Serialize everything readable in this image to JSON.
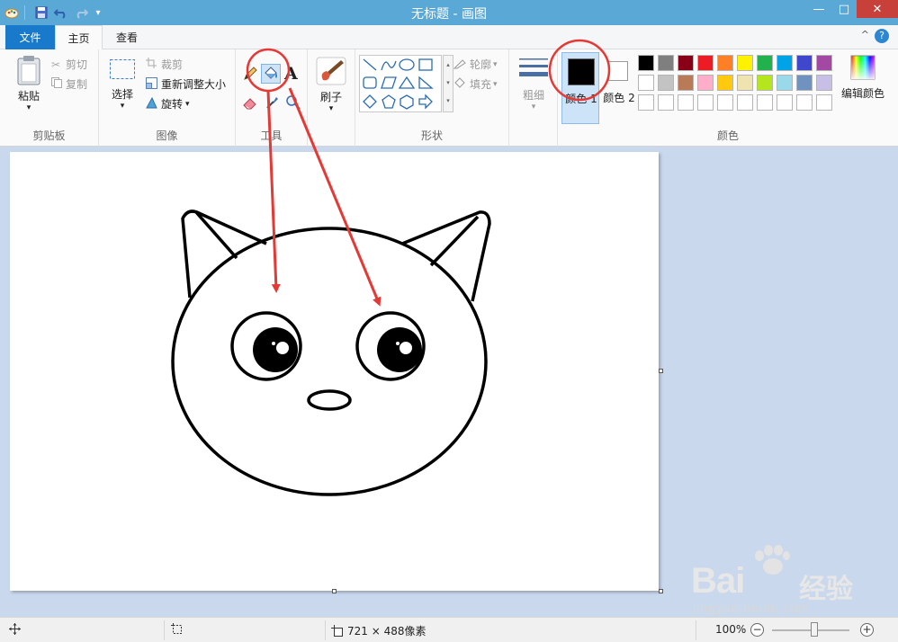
{
  "window": {
    "title": "无标题 - 画图",
    "buttons": {
      "minimize": "—",
      "maximize": "□",
      "close": "✕"
    }
  },
  "tabs": [
    {
      "label": "文件"
    },
    {
      "label": "主页"
    },
    {
      "label": "查看"
    }
  ],
  "help": "?",
  "collapse": "^",
  "ribbon": {
    "clipboard": {
      "label": "剪贴板",
      "paste": "粘贴",
      "cut": "剪切",
      "copy": "复制"
    },
    "image": {
      "label": "图像",
      "select": "选择",
      "crop": "裁剪",
      "resize": "重新调整大小",
      "rotate": "旋转"
    },
    "tools": {
      "label": "工具",
      "text_glyph": "A"
    },
    "brushes": {
      "label": "刷子"
    },
    "shapes": {
      "label": "形状",
      "outline": "轮廓",
      "fill": "填充"
    },
    "size": {
      "label": "粗细"
    },
    "colors": {
      "label": "颜色",
      "color1": "颜色 1",
      "color2": "颜色 2",
      "edit": "编辑颜色",
      "color1_value": "#000000",
      "color2_value": "#ffffff",
      "palette_row1": [
        "#000000",
        "#7f7f7f",
        "#880015",
        "#ed1c24",
        "#ff7f27",
        "#fff200",
        "#22b14c",
        "#00a2e8",
        "#3f48cc",
        "#a349a4"
      ],
      "palette_row2": [
        "#ffffff",
        "#c3c3c3",
        "#b97a57",
        "#ffaec9",
        "#ffc90e",
        "#efe4b0",
        "#b5e61d",
        "#99d9ea",
        "#7092be",
        "#c8bfe7"
      ],
      "palette_row3": [
        "#ffffff",
        "#ffffff",
        "#ffffff",
        "#ffffff",
        "#ffffff",
        "#ffffff",
        "#ffffff",
        "#ffffff",
        "#ffffff",
        "#ffffff"
      ]
    }
  },
  "status": {
    "canvas_size": "721 × 488像素",
    "zoom": "100%",
    "zoom_level": 1.0
  },
  "watermark": {
    "brand": "Bai",
    "brand_rest": "经验",
    "url": "jingyan.baidu.com"
  }
}
